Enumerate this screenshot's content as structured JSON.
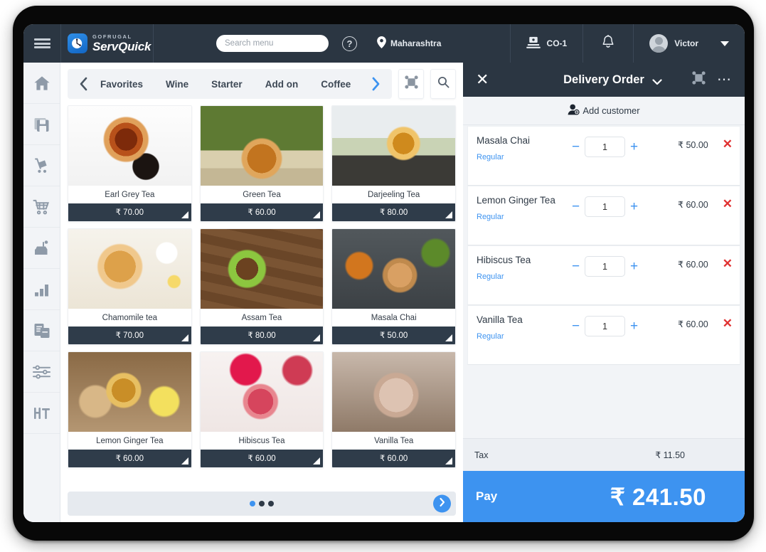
{
  "topbar": {
    "menu_icon": "hamburger-icon",
    "brand_top": "GOFRUGAL",
    "brand_name": "ServQuick",
    "logo_icon": "clock-logo-icon",
    "search_placeholder": "Search menu",
    "search_value": "",
    "help_label": "?",
    "location_icon": "map-pin-icon",
    "location": "Maharashtra",
    "counter_icon": "counter-terminal-icon",
    "counter": "CO-1",
    "notification_icon": "bell-icon",
    "user_icon": "avatar-icon",
    "user": "Victor",
    "caret_icon": "chevron-down-icon"
  },
  "sidebar": {
    "items": [
      {
        "name": "home",
        "icon": "home-icon"
      },
      {
        "name": "save",
        "icon": "floppy-disk-icon"
      },
      {
        "name": "delivery",
        "icon": "hand-truck-icon"
      },
      {
        "name": "cart",
        "icon": "shopping-cart-icon"
      },
      {
        "name": "billing",
        "icon": "cash-register-icon"
      },
      {
        "name": "reports",
        "icon": "bar-chart-icon"
      },
      {
        "name": "documents",
        "icon": "clipboard-copy-icon"
      },
      {
        "name": "settings",
        "icon": "sliders-icon"
      },
      {
        "name": "tools",
        "icon": "table-tool-icon"
      }
    ]
  },
  "categories": {
    "prev_icon": "chevron-left-icon",
    "next_icon": "chevron-right-icon",
    "items": [
      "Favorites",
      "Wine",
      "Starter",
      "Add on",
      "Coffee"
    ],
    "expand_icon": "expand-icon",
    "search_icon": "search-icon"
  },
  "products": [
    {
      "name": "Earl Grey Tea",
      "price": "₹ 70.00",
      "photo": "ph-earl"
    },
    {
      "name": "Green Tea",
      "price": "₹ 60.00",
      "photo": "ph-green"
    },
    {
      "name": "Darjeeling Tea",
      "price": "₹ 80.00",
      "photo": "ph-darj"
    },
    {
      "name": "Chamomile tea",
      "price": "₹ 70.00",
      "photo": "ph-cham"
    },
    {
      "name": "Assam Tea",
      "price": "₹ 80.00",
      "photo": "ph-assam"
    },
    {
      "name": "Masala Chai",
      "price": "₹ 50.00",
      "photo": "ph-masala"
    },
    {
      "name": "Lemon Ginger Tea",
      "price": "₹ 60.00",
      "photo": "ph-lemon"
    },
    {
      "name": "Hibiscus Tea",
      "price": "₹ 60.00",
      "photo": "ph-hib"
    },
    {
      "name": "Vanilla Tea",
      "price": "₹ 60.00",
      "photo": "ph-van"
    }
  ],
  "pager": {
    "total_dots": 3,
    "active_dot": 1,
    "next_icon": "chevron-right-icon"
  },
  "order": {
    "close_icon": "close-icon",
    "title": "Delivery Order",
    "title_caret_icon": "chevron-down-icon",
    "expand_icon": "expand-icon",
    "more_icon": "more-options-icon",
    "add_customer_icon": "add-customer-icon",
    "add_customer_label": "Add customer",
    "minus_icon": "minus-icon",
    "plus_icon": "plus-icon",
    "delete_icon": "remove-item-icon",
    "items": [
      {
        "name": "Masala Chai",
        "variant": "Regular",
        "qty": "1",
        "price": "₹ 50.00"
      },
      {
        "name": "Lemon Ginger Tea",
        "variant": "Regular",
        "qty": "1",
        "price": "₹ 60.00"
      },
      {
        "name": "Hibiscus Tea",
        "variant": "Regular",
        "qty": "1",
        "price": "₹ 60.00"
      },
      {
        "name": "Vanilla Tea",
        "variant": "Regular",
        "qty": "1",
        "price": "₹ 60.00"
      }
    ],
    "tax_label": "Tax",
    "tax_value": "₹ 11.50",
    "pay_label": "Pay",
    "pay_amount": "₹ 241.50"
  },
  "colors": {
    "header_dark": "#2b3642",
    "accent_blue": "#3d93f0",
    "tile_footer": "#2f3c4a",
    "delete_red": "#e03131",
    "rail_bg": "#f2f4f7"
  }
}
